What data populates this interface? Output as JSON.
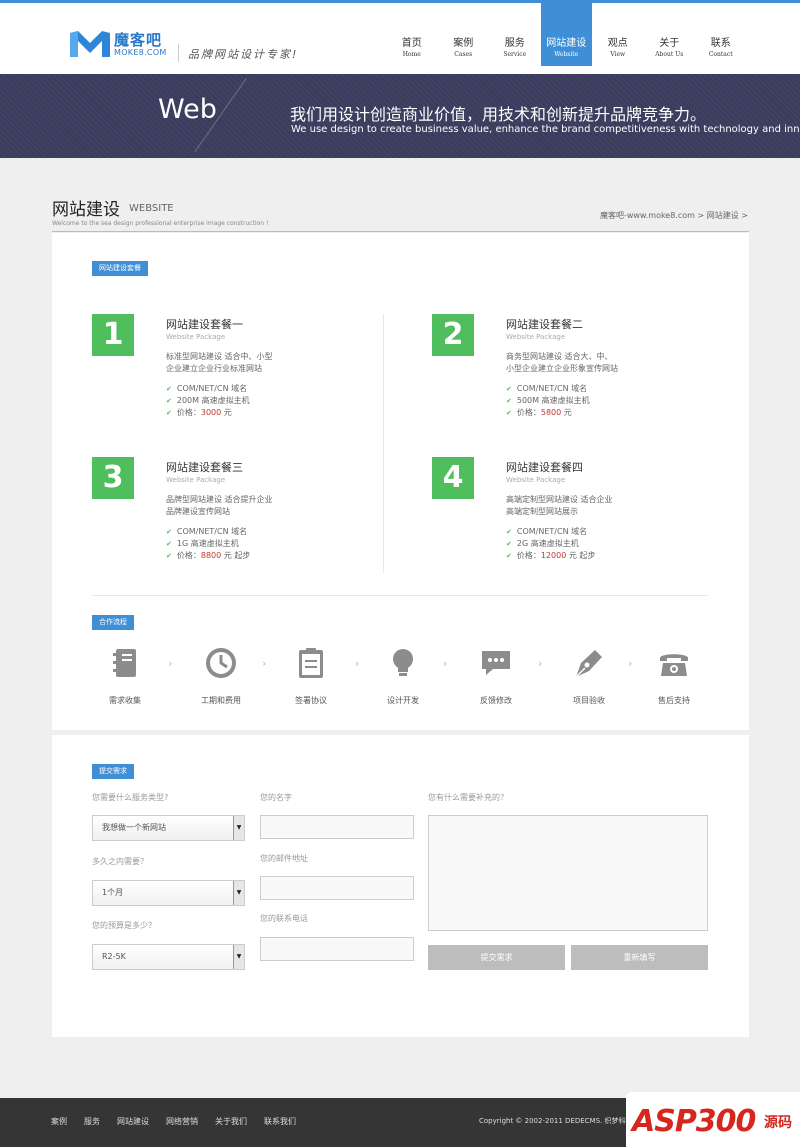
{
  "colors": {
    "accent": "#3f8fd6",
    "banner": "#3a3d5d",
    "package": "#4fbf5e",
    "price": "#c0392b",
    "footer": "#353535",
    "button": "#bdbdbd"
  },
  "header": {
    "logo_cn": "魔客吧",
    "logo_en": "MOKE8.COM",
    "slogan": "品牌网站设计专家!",
    "nav": [
      {
        "cn": "首页",
        "en": "Home"
      },
      {
        "cn": "案例",
        "en": "Cases"
      },
      {
        "cn": "服务",
        "en": "Service"
      },
      {
        "cn": "网站建设",
        "en": "Website"
      },
      {
        "cn": "观点",
        "en": "View"
      },
      {
        "cn": "关于",
        "en": "About Us"
      },
      {
        "cn": "联系",
        "en": "Contact"
      }
    ],
    "active_nav": "网站建设"
  },
  "banner": {
    "word": "Web",
    "cn": "我们用设计创造商业价值，用技术和创新提升品牌竞争力。",
    "en": "We use design to create business value, enhance the brand competitiveness with technology and innovation."
  },
  "page": {
    "title_cn": "网站建设",
    "title_en": "WEBSITE",
    "subtitle": "Welcome to the sea design professional enterprise image construction !",
    "breadcrumb": "魔客吧-www.moke8.com > 网站建设 >"
  },
  "packages_tag": "网站建设套餐",
  "packages": [
    {
      "num": "1",
      "title": "网站建设套餐一",
      "en": "Website Package",
      "desc": [
        "标准型网站建设 适合中、小型",
        "企业建立企业行业标准网站"
      ],
      "features": [
        "COM/NET/CN 域名",
        "200M 高速虚拟主机"
      ],
      "price_label": "价格：",
      "price": "3000",
      "price_unit": "元"
    },
    {
      "num": "2",
      "title": "网站建设套餐二",
      "en": "Website Package",
      "desc": [
        "商务型网站建设 适合大、中、",
        "小型企业建立企业形象宣传网站"
      ],
      "features": [
        "COM/NET/CN 域名",
        "500M 高速虚拟主机"
      ],
      "price_label": "价格：",
      "price": "5800",
      "price_unit": "元"
    },
    {
      "num": "3",
      "title": "网站建设套餐三",
      "en": "Website Package",
      "desc": [
        "品牌型网站建设 适合提升企业",
        "品牌建设宣传网站"
      ],
      "features": [
        "COM/NET/CN 域名",
        "1G 高速虚拟主机"
      ],
      "price_label": "价格：",
      "price": "8800",
      "price_unit": "元 起步"
    },
    {
      "num": "4",
      "title": "网站建设套餐四",
      "en": "Website Package",
      "desc": [
        "高端定制型网站建设 适合企业",
        "高端定制型网站展示"
      ],
      "features": [
        "COM/NET/CN 域名",
        "2G 高速虚拟主机"
      ],
      "price_label": "价格：",
      "price": "12000",
      "price_unit": "元 起步"
    }
  ],
  "process_tag": "合作流程",
  "process": [
    {
      "icon": "notebook-icon",
      "label": "需求收集"
    },
    {
      "icon": "clock-icon",
      "label": "工期和费用"
    },
    {
      "icon": "clipboard-icon",
      "label": "签署协议"
    },
    {
      "icon": "lightbulb-icon",
      "label": "设计开发"
    },
    {
      "icon": "chat-bubble-icon",
      "label": "反馈修改"
    },
    {
      "icon": "pen-nib-icon",
      "label": "项目验收"
    },
    {
      "icon": "telephone-icon",
      "label": "售后支持"
    }
  ],
  "form": {
    "tag": "提交需求",
    "service_label": "您需要什么服务类型?",
    "service_value": "我想做一个新网站",
    "time_label": "多久之内需要？",
    "time_value": "1个月",
    "budget_label": "您的预算是多少？",
    "budget_value": "R2-5K",
    "name_label": "您的名字",
    "email_label": "您的邮件地址",
    "phone_label": "您的联系电话",
    "extra_label": "您有什么需要补充的？",
    "submit": "提交需求",
    "reset": "重新填写"
  },
  "footer": {
    "links": [
      "案例",
      "服务",
      "网站建设",
      "网络营销",
      "关于我们",
      "联系我们"
    ],
    "copyright": "Copyright © 2002-2011 DEDECMS. 织梦科技"
  },
  "watermark": {
    "text": "ASP300",
    "side": "源码"
  }
}
